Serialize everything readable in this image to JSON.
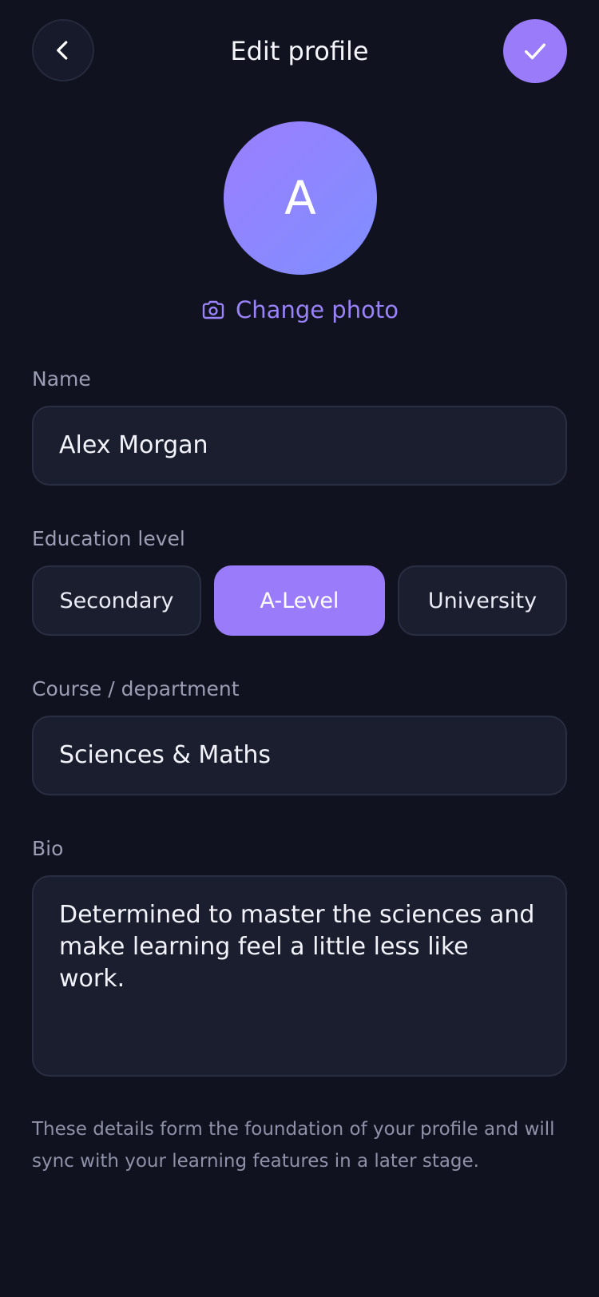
{
  "header": {
    "title": "Edit profile",
    "back_icon": "chevron-left-icon",
    "save_icon": "check-icon"
  },
  "avatar": {
    "initial": "A"
  },
  "change_photo": {
    "label": "Change photo",
    "icon": "camera-icon"
  },
  "form": {
    "name": {
      "label": "Name",
      "value": "Alex Morgan"
    },
    "education": {
      "label": "Education level",
      "options": [
        "Secondary",
        "A-Level",
        "University"
      ],
      "selected": "A-Level"
    },
    "course": {
      "label": "Course / department",
      "value": "Sciences & Maths"
    },
    "bio": {
      "label": "Bio",
      "value": "Determined to master the sciences and make learning feel a little less like work."
    }
  },
  "footer": {
    "note": "These details form the foundation of your profile and will sync with your learning features in a later stage."
  },
  "colors": {
    "background": "#10121f",
    "accent": "#9a7cfb",
    "field_bg": "#1b1e2e",
    "muted_text": "#9b9db4"
  }
}
